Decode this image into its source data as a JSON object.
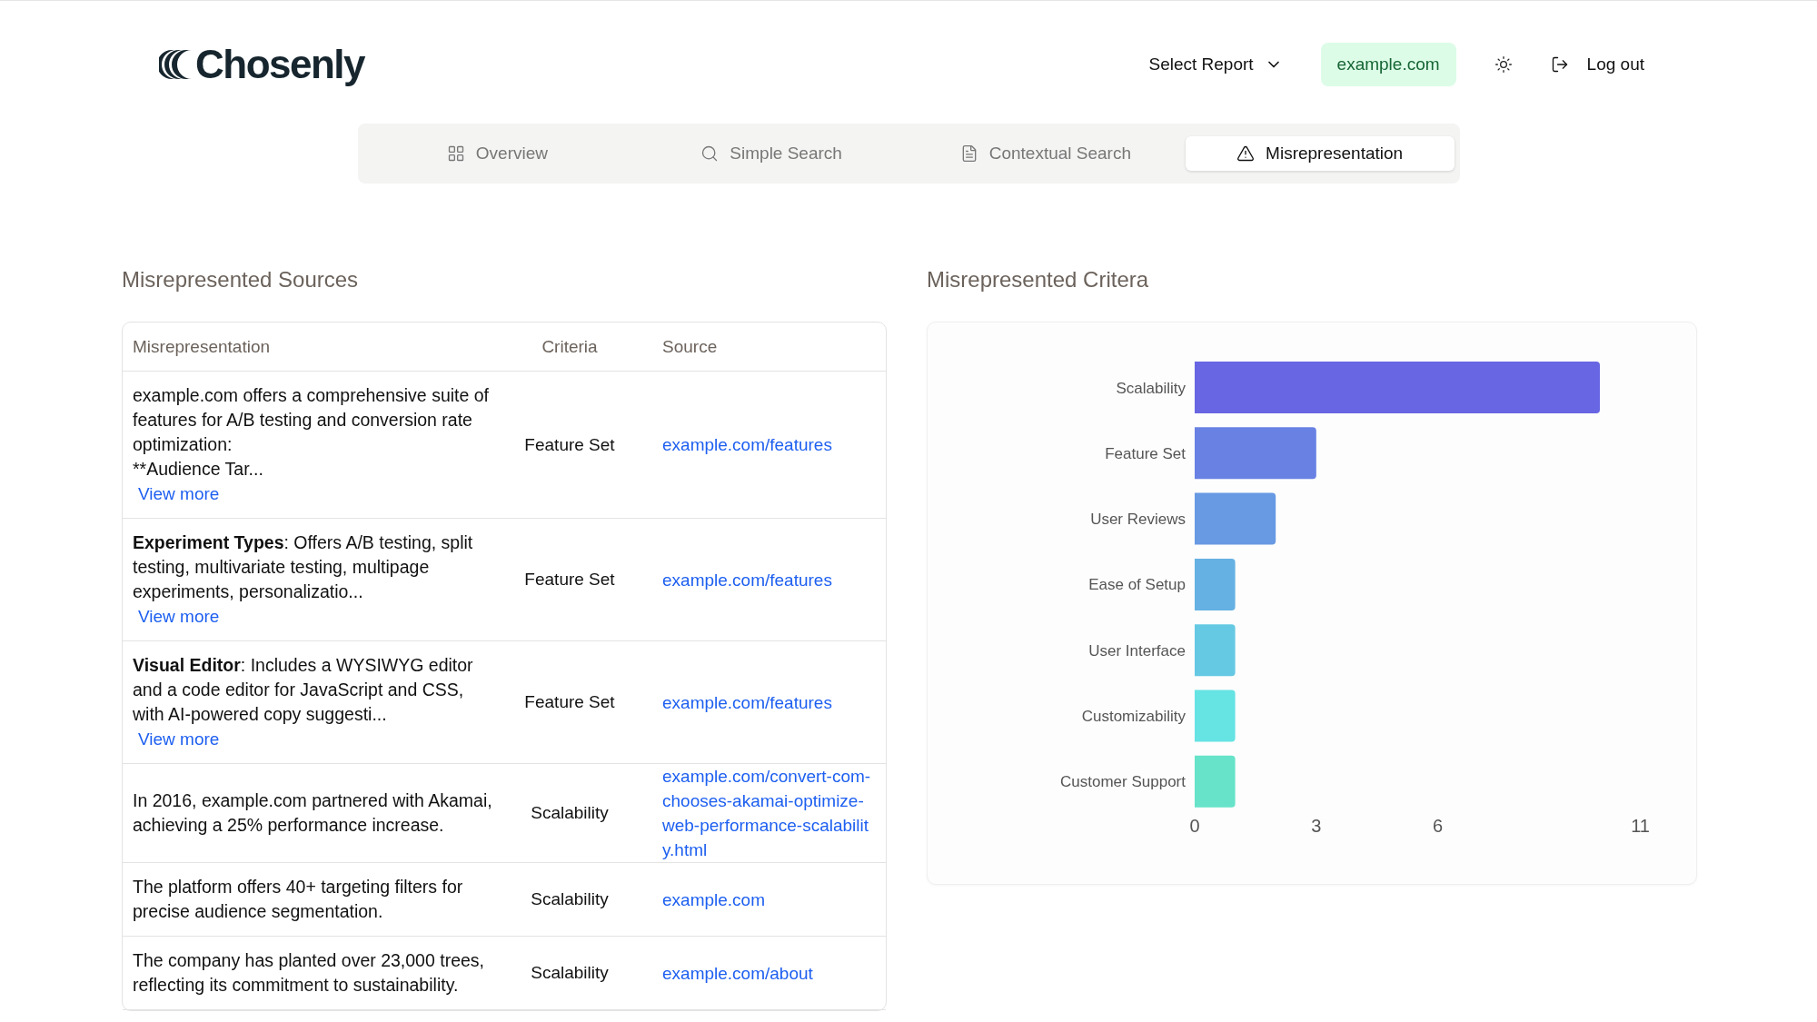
{
  "header": {
    "logo": "Chosenly",
    "report_select": "Select Report",
    "domain_badge": "example.com",
    "logout": "Log out"
  },
  "tabs": [
    {
      "label": "Overview",
      "selected": false
    },
    {
      "label": "Simple Search",
      "selected": false
    },
    {
      "label": "Contextual Search",
      "selected": false
    },
    {
      "label": "Misrepresentation",
      "selected": true
    }
  ],
  "sources": {
    "title": "Misrepresented Sources",
    "columns": [
      "Misrepresentation",
      "Criteria",
      "Source"
    ],
    "rows": [
      {
        "text": "example.com offers a comprehensive suite of features for A/B testing and conversion rate optimization:\n**Audience Tar...",
        "more": "View more",
        "criteria": "Feature Set",
        "source": "example.com/features"
      },
      {
        "lead": "Experiment Types",
        "text": ": Offers A/B testing, split testing, multivariate testing, multipage experiments, personalizatio...",
        "more": "View more",
        "criteria": "Feature Set",
        "source": "example.com/features"
      },
      {
        "lead": "Visual Editor",
        "text": ": Includes a WYSIWYG editor and a code editor for JavaScript and CSS, with AI-powered copy suggesti...",
        "more": "View more",
        "criteria": "Feature Set",
        "source": "example.com/features"
      },
      {
        "text": "In 2016, example.com partnered with Akamai, achieving a 25% performance increase.",
        "criteria": "Scalability",
        "source": "example.com/convert-com-chooses-akamai-optimize-web-performance-scalability.html"
      },
      {
        "text": "The platform offers 40+ targeting filters for precise audience segmentation.",
        "criteria": "Scalability",
        "source": "example.com"
      },
      {
        "text": "The company has planted over 23,000 trees, reflecting its commitment to sustainability.",
        "criteria": "Scalability",
        "source": "example.com/about"
      }
    ]
  },
  "criteria": {
    "title": "Misrepresented Critera",
    "chart_data": {
      "type": "bar",
      "orientation": "horizontal",
      "categories": [
        "Scalability",
        "Feature Set",
        "User Reviews",
        "Ease of Setup",
        "User Interface",
        "Customizability",
        "Customer Support"
      ],
      "series": [
        {
          "color": "#6866e3",
          "values": [
            10,
            null,
            null,
            null,
            null,
            null,
            null
          ]
        },
        {
          "color": "#6881e3",
          "values": [
            null,
            3,
            null,
            null,
            null,
            null,
            null
          ]
        },
        {
          "color": "#6899e3",
          "values": [
            null,
            null,
            2,
            null,
            null,
            null,
            null
          ]
        },
        {
          "color": "#66b1e3",
          "values": [
            null,
            null,
            null,
            1,
            null,
            null,
            null
          ]
        },
        {
          "color": "#66c9e3",
          "values": [
            null,
            null,
            null,
            null,
            1,
            null,
            null
          ]
        },
        {
          "color": "#66e3e3",
          "values": [
            null,
            null,
            null,
            null,
            null,
            1,
            null
          ]
        },
        {
          "color": "#66e3c9",
          "values": [
            null,
            null,
            null,
            null,
            null,
            null,
            1
          ]
        }
      ],
      "xlim": [
        0,
        11
      ],
      "xticks": [
        0,
        3,
        6,
        11
      ]
    }
  }
}
